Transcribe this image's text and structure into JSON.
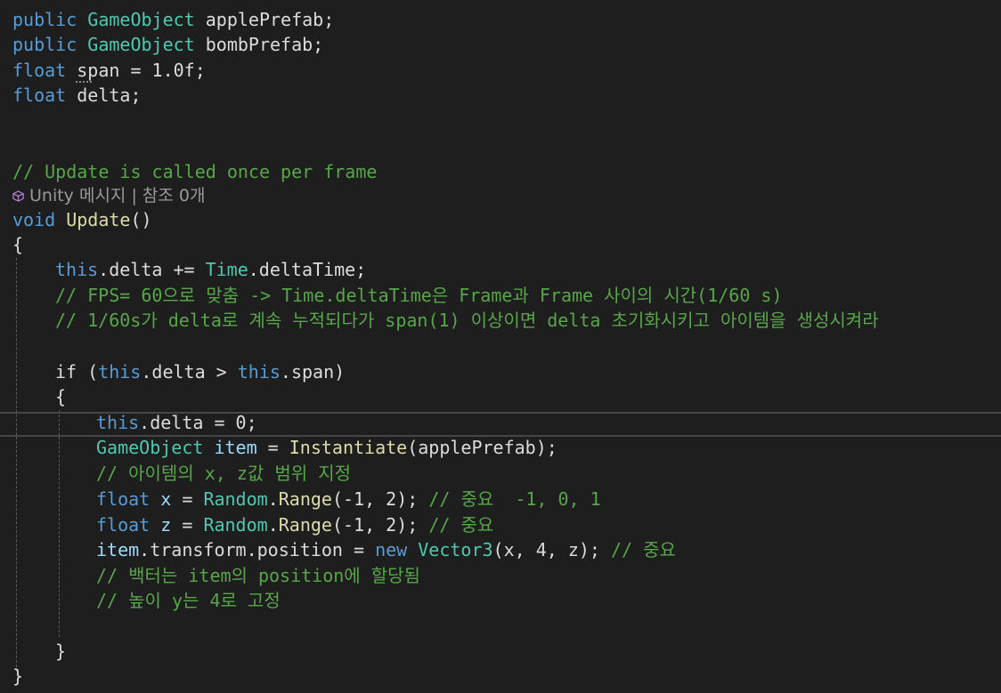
{
  "editor": {
    "lines": {
      "l1": {
        "kw": "public",
        "type": "GameObject",
        "rest": " applePrefab;"
      },
      "l2": {
        "kw": "public",
        "type": "GameObject",
        "rest": " bombPrefab;"
      },
      "l3": {
        "kw": "float",
        "name": " span",
        "rest": " = 1.0f;"
      },
      "l4": {
        "kw": "float",
        "rest": " delta;"
      },
      "comment_update": "// Update is called once per frame",
      "codelens": "Unity 메시지 | 참조 0개",
      "l_void": {
        "kw": "void",
        "fn": "Update",
        "rest": "()"
      },
      "brace_open": "{",
      "l_delta": {
        "kw": "this",
        "mid": ".delta += ",
        "type": "Time",
        "rest": ".deltaTime;"
      },
      "comment_fps": "// FPS= 60으로 맞춤 -> Time.deltaTime은 Frame과 Frame 사이의 시간(1/60 s)",
      "comment_accum": "// 1/60s가 delta로 계속 누적되다가 span(1) 이상이면 delta 초기화시키고 아이템을 생성시켜라",
      "l_if": {
        "kw": "if",
        "open": " (",
        "this1": "this",
        "mid": ".delta > ",
        "this2": "this",
        "rest": ".span)"
      },
      "if_brace_open": "{",
      "l_reset": {
        "kw": "this",
        "rest": ".delta = 0;"
      },
      "l_item": {
        "type": "GameObject",
        "var": " item",
        "eq": " = ",
        "fn": "Instantiate",
        "rest": "(applePrefab);"
      },
      "comment_range": "// 아이템의 x, z값 범위 지정",
      "l_x": {
        "kw": "float",
        "var": " x",
        "eq": " = ",
        "type": "Random",
        "dot": ".",
        "fn": "Range",
        "args": "(-1, 2);",
        "comment": " // 중요  -1, 0, 1"
      },
      "l_z": {
        "kw": "float",
        "var": " z",
        "eq": " = ",
        "type": "Random",
        "dot": ".",
        "fn": "Range",
        "args": "(-1, 2);",
        "comment": " // 중요"
      },
      "l_pos": {
        "var": "item",
        "mid": ".transform.position = ",
        "kw": "new",
        "type": " Vector3",
        "rest": "(x, 4, z);",
        "comment": " // 중요"
      },
      "comment_vector": "// 백터는 item의 position에 할당됨",
      "comment_height": "// 높이 y는 4로 고정",
      "if_brace_close": "}",
      "brace_close": "}"
    },
    "colors": {
      "background": "#1e1e1e",
      "keyword": "#569cd6",
      "type": "#4ec9b0",
      "method": "#dcdcaa",
      "comment": "#57a64a",
      "codelens": "#999999",
      "unity_icon": "#b180d7"
    },
    "icons": {
      "codelens_icon": "unity-cube-icon"
    }
  }
}
